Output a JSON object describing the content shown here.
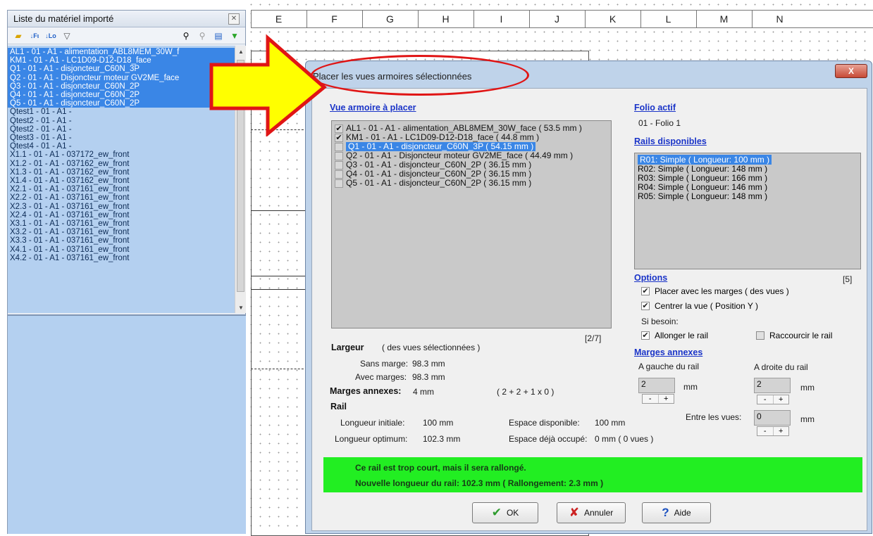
{
  "canvas": {
    "columns": [
      "E",
      "F",
      "G",
      "H",
      "I",
      "J",
      "K",
      "L",
      "M",
      "N"
    ]
  },
  "left_panel": {
    "title": "Liste du matériel importé",
    "toolbar": {
      "folder_icon": "folder-icon",
      "sort_a": "sort-name-icon",
      "sort_b": "sort-location-icon",
      "filter": "filter-icon",
      "find": "binoculars-icon",
      "find_next": "find-next-icon",
      "layout": "layout-icon",
      "import": "import-green-icon"
    },
    "items": [
      {
        "label": "AL1 - 01 - A1 - alimentation_ABL8MEM_30W_f",
        "selected": true
      },
      {
        "label": "KM1 - 01 - A1 - LC1D09-D12-D18_face",
        "selected": true
      },
      {
        "label": "Q1 - 01 - A1 - disjoncteur_C60N_3P",
        "selected": true
      },
      {
        "label": "Q2 - 01 - A1 - Disjoncteur moteur GV2ME_face",
        "selected": true
      },
      {
        "label": "Q3 - 01 - A1 - disjoncteur_C60N_2P",
        "selected": true
      },
      {
        "label": "Q4 - 01 - A1 - disjoncteur_C60N_2P",
        "selected": true
      },
      {
        "label": "Q5 - 01 - A1 - disjoncteur_C60N_2P",
        "selected": true
      },
      {
        "label": "Qtest1 - 01 - A1 -",
        "selected": false
      },
      {
        "label": "Qtest2 - 01 - A1 -",
        "selected": false
      },
      {
        "label": "Qtest2 - 01 - A1 -",
        "selected": false
      },
      {
        "label": "Qtest3 - 01 - A1 -",
        "selected": false
      },
      {
        "label": "Qtest4 - 01 - A1 -",
        "selected": false
      },
      {
        "label": "X1.1 - 01 - A1 - 037172_ew_front",
        "selected": false
      },
      {
        "label": "X1.2 - 01 - A1 - 037162_ew_front",
        "selected": false
      },
      {
        "label": "X1.3 - 01 - A1 - 037162_ew_front",
        "selected": false
      },
      {
        "label": "X1.4 - 01 - A1 - 037162_ew_front",
        "selected": false
      },
      {
        "label": "X2.1 - 01 - A1 - 037161_ew_front",
        "selected": false
      },
      {
        "label": "X2.2 - 01 - A1 - 037161_ew_front",
        "selected": false
      },
      {
        "label": "X2.3 - 01 - A1 - 037161_ew_front",
        "selected": false
      },
      {
        "label": "X2.4 - 01 - A1 - 037161_ew_front",
        "selected": false
      },
      {
        "label": "X3.1 - 01 - A1 - 037161_ew_front",
        "selected": false
      },
      {
        "label": "X3.2 - 01 - A1 - 037161_ew_front",
        "selected": false
      },
      {
        "label": "X3.3 - 01 - A1 - 037161_ew_front",
        "selected": false
      },
      {
        "label": "X4.1 - 01 - A1 - 037161_ew_front",
        "selected": false
      },
      {
        "label": "X4.2 - 01 - A1 - 037161_ew_front",
        "selected": false
      }
    ]
  },
  "dialog": {
    "title": "Placer les vues armoires sélectionnées",
    "close_label": "X",
    "views_header": "Vue armoire à placer",
    "views": [
      {
        "label": "AL1 - 01 - A1 - alimentation_ABL8MEM_30W_face ( 53.5 mm )",
        "checked": true,
        "selected": false
      },
      {
        "label": "KM1 - 01 - A1 - LC1D09-D12-D18_face ( 44.8 mm )",
        "checked": true,
        "selected": false
      },
      {
        "label": "Q1 - 01 - A1 - disjoncteur_C60N_3P ( 54.15 mm )",
        "checked": false,
        "selected": true
      },
      {
        "label": "Q2 - 01 - A1 - Disjoncteur moteur GV2ME_face ( 44.49 mm )",
        "checked": false,
        "selected": false
      },
      {
        "label": "Q3 - 01 - A1 - disjoncteur_C60N_2P ( 36.15 mm )",
        "checked": false,
        "selected": false
      },
      {
        "label": "Q4 - 01 - A1 - disjoncteur_C60N_2P ( 36.15 mm )",
        "checked": false,
        "selected": false
      },
      {
        "label": "Q5 - 01 - A1 - disjoncteur_C60N_2P ( 36.15 mm )",
        "checked": false,
        "selected": false
      }
    ],
    "views_count": "[2/7]",
    "folio_header": "Folio actif",
    "folio_value": "01 - Folio 1",
    "rails_header": "Rails disponibles",
    "rails": [
      {
        "label": "R01: Simple ( Longueur: 100 mm )",
        "selected": true
      },
      {
        "label": "R02: Simple ( Longueur: 148 mm )",
        "selected": false
      },
      {
        "label": "R03: Simple ( Longueur: 166 mm )",
        "selected": false
      },
      {
        "label": "R04: Simple ( Longueur: 146 mm )",
        "selected": false
      },
      {
        "label": "R05: Simple ( Longueur: 148 mm )",
        "selected": false
      }
    ],
    "options_header": "Options",
    "options_count": "[5]",
    "options": {
      "margins_label": "Placer avec les marges ( des vues )",
      "center_label": "Centrer la vue ( Position Y )",
      "if_needed": "Si besoin:",
      "lengthen_label": "Allonger le rail",
      "shorten_label": "Raccourcir le rail"
    },
    "annex_header": "Marges annexes",
    "annex": {
      "left_label": "A gauche du rail",
      "right_label": "A droite du rail",
      "left_value": "2",
      "right_value": "2",
      "between_label": "Entre les vues:",
      "between_value": "0",
      "unit": "mm",
      "minus": "-",
      "plus": "+"
    },
    "width": {
      "title": "Largeur",
      "subtitle": "( des vues sélectionnées )",
      "without_label": "Sans marge:",
      "without_value": "98.3 mm",
      "with_label": "Avec marges:",
      "with_value": "98.3 mm",
      "annex_label": "Marges annexes:",
      "annex_value": "4 mm",
      "formula": "( 2 + 2 + 1 x 0 )"
    },
    "rail": {
      "title": "Rail",
      "initial_label": "Longueur initiale:",
      "initial_value": "100 mm",
      "optimum_label": "Longueur optimum:",
      "optimum_value": "102.3 mm",
      "available_label": "Espace disponible:",
      "available_value": "100 mm",
      "occupied_label": "Espace déjà occupé:",
      "occupied_value": "0 mm ( 0 vues )"
    },
    "status": {
      "line1": "Ce rail est trop court, mais il sera rallongé.",
      "line2": "Nouvelle longueur du rail: 102.3 mm ( Rallongement: 2.3 mm )",
      "color": "#22ee22"
    },
    "buttons": {
      "ok": "OK",
      "cancel": "Annuler",
      "help": "Aide"
    }
  }
}
